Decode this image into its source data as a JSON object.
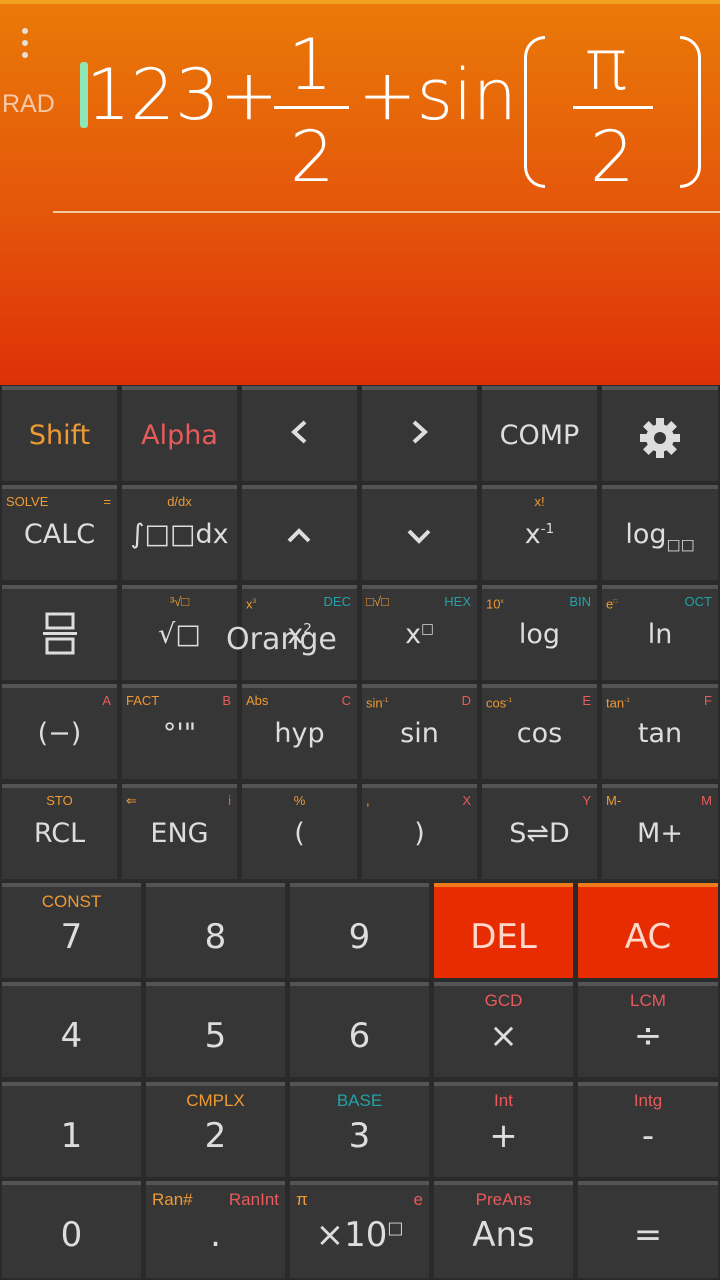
{
  "display": {
    "angle_mode": "RAD",
    "expression": {
      "integer_part": "123+",
      "frac1_num": "1",
      "frac1_den": "2",
      "plus_sin": "+sin",
      "frac2_num": "π",
      "frac2_den": "2"
    }
  },
  "toast": "Orange",
  "keys": {
    "shift": "Shift",
    "alpha": "Alpha",
    "left": "‹",
    "right": "›",
    "comp": "COMP",
    "calc": {
      "label": "CALC",
      "sub_left": "SOLVE",
      "sub_right": "="
    },
    "integral": {
      "label": "∫□□dx",
      "sub": "d/dx"
    },
    "up": "˄",
    "down": "˅",
    "inverse": {
      "label": "x",
      "sup": "-1",
      "sub": "x!"
    },
    "logb": {
      "label": "log",
      "sub": "□□"
    },
    "fraction": "⌸",
    "sqrt": {
      "label": "√□",
      "sub": "³√□"
    },
    "square": {
      "label": "x",
      "sup": "2",
      "sub_left": "x",
      "sub_left_sup": "3",
      "sub_right": "DEC"
    },
    "power": {
      "label": "x",
      "sup": "□",
      "sub_left": "□√□",
      "sub_right": "HEX"
    },
    "log": {
      "label": "log",
      "sub_left": "10",
      "sub_left_sup": "x",
      "sub_right": "BIN"
    },
    "ln": {
      "label": "ln",
      "sub_left": "e",
      "sub_left_sup": "□",
      "sub_right": "OCT"
    },
    "neg": {
      "label": "(−)",
      "sub_right": "A"
    },
    "dms": {
      "label": "°'\"",
      "sub_left": "FACT",
      "sub_right": "B"
    },
    "hyp": {
      "label": "hyp",
      "sub_left": "Abs",
      "sub_right": "C"
    },
    "sin": {
      "label": "sin",
      "sub_left": "sin",
      "sub_left_sup": "-1",
      "sub_right": "D"
    },
    "cos": {
      "label": "cos",
      "sub_left": "cos",
      "sub_left_sup": "-1",
      "sub_right": "E"
    },
    "tan": {
      "label": "tan",
      "sub_left": "tan",
      "sub_left_sup": "-1",
      "sub_right": "F"
    },
    "rcl": {
      "label": "RCL",
      "sub": "STO"
    },
    "eng": {
      "label": "ENG",
      "sub_left": "⇐",
      "sub_right": "i"
    },
    "lparen": {
      "label": "(",
      "sub": "%"
    },
    "rparen": {
      "label": ")",
      "sub_left": ",",
      "sub_right": "X"
    },
    "sd": {
      "label": "S⇌D",
      "sub_right": "Y"
    },
    "mplus": {
      "label": "M+",
      "sub_left": "M-",
      "sub_right": "M"
    },
    "seven": {
      "label": "7",
      "sub": "CONST"
    },
    "eight": {
      "label": "8"
    },
    "nine": {
      "label": "9"
    },
    "del": {
      "label": "DEL"
    },
    "ac": {
      "label": "AC"
    },
    "four": {
      "label": "4"
    },
    "five": {
      "label": "5"
    },
    "six": {
      "label": "6"
    },
    "times": {
      "label": "×",
      "sub": "GCD"
    },
    "divide": {
      "label": "÷",
      "sub": "LCM"
    },
    "one": {
      "label": "1"
    },
    "two": {
      "label": "2",
      "sub": "CMPLX"
    },
    "three": {
      "label": "3",
      "sub": "BASE"
    },
    "plus": {
      "label": "+",
      "sub": "Int"
    },
    "minus": {
      "label": "-",
      "sub": "Intg"
    },
    "zero": {
      "label": "0"
    },
    "dot": {
      "label": ".",
      "sub_left": "Ran#",
      "sub_right": "RanInt"
    },
    "exp": {
      "label": "×10",
      "sup": "□",
      "sub_left": "π",
      "sub_right": "e"
    },
    "ans": {
      "label": "Ans",
      "sub": "PreAns"
    },
    "equals": {
      "label": "="
    }
  },
  "colors": {
    "display_top": "#ea7a08",
    "display_bottom": "#de3008",
    "key_bg": "#363636",
    "shift_orange": "#ef9a32",
    "alpha_red": "#e95a5a",
    "mode_teal": "#22a3a7",
    "del_red": "#e62c00"
  }
}
